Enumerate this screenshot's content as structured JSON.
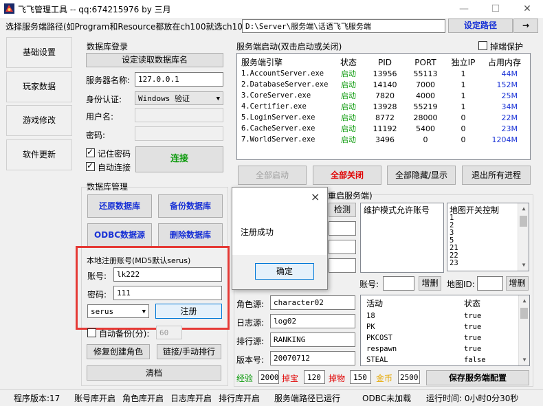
{
  "window": {
    "title": "飞飞管理工具 -- qq:674215976     by 三月"
  },
  "path_bar": {
    "label": "选择服务端路径(如Program和Resource都放在ch100就选ch100):",
    "value": "D:\\Server\\服务端\\话语飞飞服务端",
    "set_button": "设定路径",
    "arrow_button": "→"
  },
  "sidebar": {
    "items": [
      "基础设置",
      "玩家数据",
      "游戏修改",
      "软件更新"
    ]
  },
  "db_login": {
    "title": "数据库登录",
    "read_button": "设定读取数据库名",
    "server_label": "服务器名称:",
    "server_value": "127.0.0.1",
    "auth_label": "身份认证:",
    "auth_value": "Windows 验证",
    "user_label": "用户名:",
    "user_value": "",
    "password_label": "密码:",
    "password_value": "",
    "remember_label": "记住密码",
    "autoconnect_label": "自动连接",
    "connect_button": "连接"
  },
  "db_manage": {
    "title": "数据库管理",
    "restore_button": "还原数据库",
    "backup_button": "备份数据库",
    "odbc_button": "ODBC数据源",
    "delete_button": "删除数据库"
  },
  "register": {
    "title": "本地注册账号(MD5默认serus)",
    "account_label": "账号:",
    "account_value": "lk222",
    "password_label": "密码:",
    "password_value": "111",
    "salt_value": "serus",
    "register_button": "注册"
  },
  "bottom_left": {
    "autobackup_label": "自动备份(分):",
    "autobackup_value": "60",
    "fix_role_button": "修复创建角色",
    "link_rank_button": "链接/手动排行",
    "clear_button": "清档"
  },
  "server_panel": {
    "title": "服务端启动(双击启动或关闭)",
    "kick_protect_label": "掉端保护",
    "columns": [
      "服务端引擎",
      "状态",
      "PID",
      "PORT",
      "独立IP",
      "占用内存"
    ],
    "rows": [
      {
        "name": "1.AccountServer.exe",
        "status": "启动",
        "pid": "13956",
        "port": "55113",
        "ip": "1",
        "mem": "44M"
      },
      {
        "name": "2.DatabaseServer.exe",
        "status": "启动",
        "pid": "14140",
        "port": "7000",
        "ip": "1",
        "mem": "152M"
      },
      {
        "name": "3.CoreServer.exe",
        "status": "启动",
        "pid": "7820",
        "port": "4000",
        "ip": "1",
        "mem": "25M"
      },
      {
        "name": "4.Certifier.exe",
        "status": "启动",
        "pid": "13928",
        "port": "55219",
        "ip": "1",
        "mem": "34M"
      },
      {
        "name": "5.LoginServer.exe",
        "status": "启动",
        "pid": "8772",
        "port": "28000",
        "ip": "0",
        "mem": "22M"
      },
      {
        "name": "6.CacheServer.exe",
        "status": "启动",
        "pid": "11192",
        "port": "5400",
        "ip": "0",
        "mem": "23M"
      },
      {
        "name": "7.WorldServer.exe",
        "status": "启动",
        "pid": "3496",
        "port": "0",
        "ip": "0",
        "mem": "1204M"
      }
    ],
    "start_all": "全部启动",
    "close_all": "全部关闭",
    "hide_show": "全部隐藏/显示",
    "exit_all": "退出所有进程"
  },
  "config_panel": {
    "title_suffix": "重启服务端)",
    "check_button": "检测",
    "maint_label": "维护模式允许账号",
    "mapswitch_label": "地图开关控制",
    "map_list": [
      "1",
      "2",
      "3",
      "5",
      "21",
      "22",
      "23"
    ],
    "account_label": "账号:",
    "add_button_1": "增删",
    "mapid_label": "地图ID:",
    "add_button_2": "增删",
    "role_src_label": "角色源:",
    "role_src_value": "character02",
    "log_src_label": "日志源:",
    "log_src_value": "log02",
    "rank_src_label": "排行源:",
    "rank_src_value": "RANKING",
    "version_label": "版本号:",
    "version_value": "20070712",
    "activity_header": "活动",
    "state_header": "状态",
    "activities": [
      {
        "name": "18",
        "state": "true"
      },
      {
        "name": "PK",
        "state": "true"
      },
      {
        "name": "PKCOST",
        "state": "true"
      },
      {
        "name": "respawn",
        "state": "true"
      },
      {
        "name": "STEAL",
        "state": "false"
      }
    ],
    "exp_label": "经验",
    "exp_value": "2000",
    "drop_label": "掉宝",
    "drop_value": "120",
    "item_label": "掉物",
    "item_value": "150",
    "gold_label": "金币",
    "gold_value": "2500",
    "save_button": "保存服务端配置"
  },
  "dialog": {
    "message": "注册成功",
    "ok_button": "确定",
    "close_icon": "×"
  },
  "status_bar": {
    "items": [
      "程序版本:17",
      "账号库开启",
      "角色库开启",
      "日志库开启",
      "排行库开启",
      "服务端路径已运行",
      "ODBC未加载",
      "运行时间: 0小时0分30秒"
    ]
  },
  "colors": {
    "green": "#0a9a0a",
    "blue": "#1a33d6",
    "red": "#e00000",
    "highlight": "#e53935"
  }
}
